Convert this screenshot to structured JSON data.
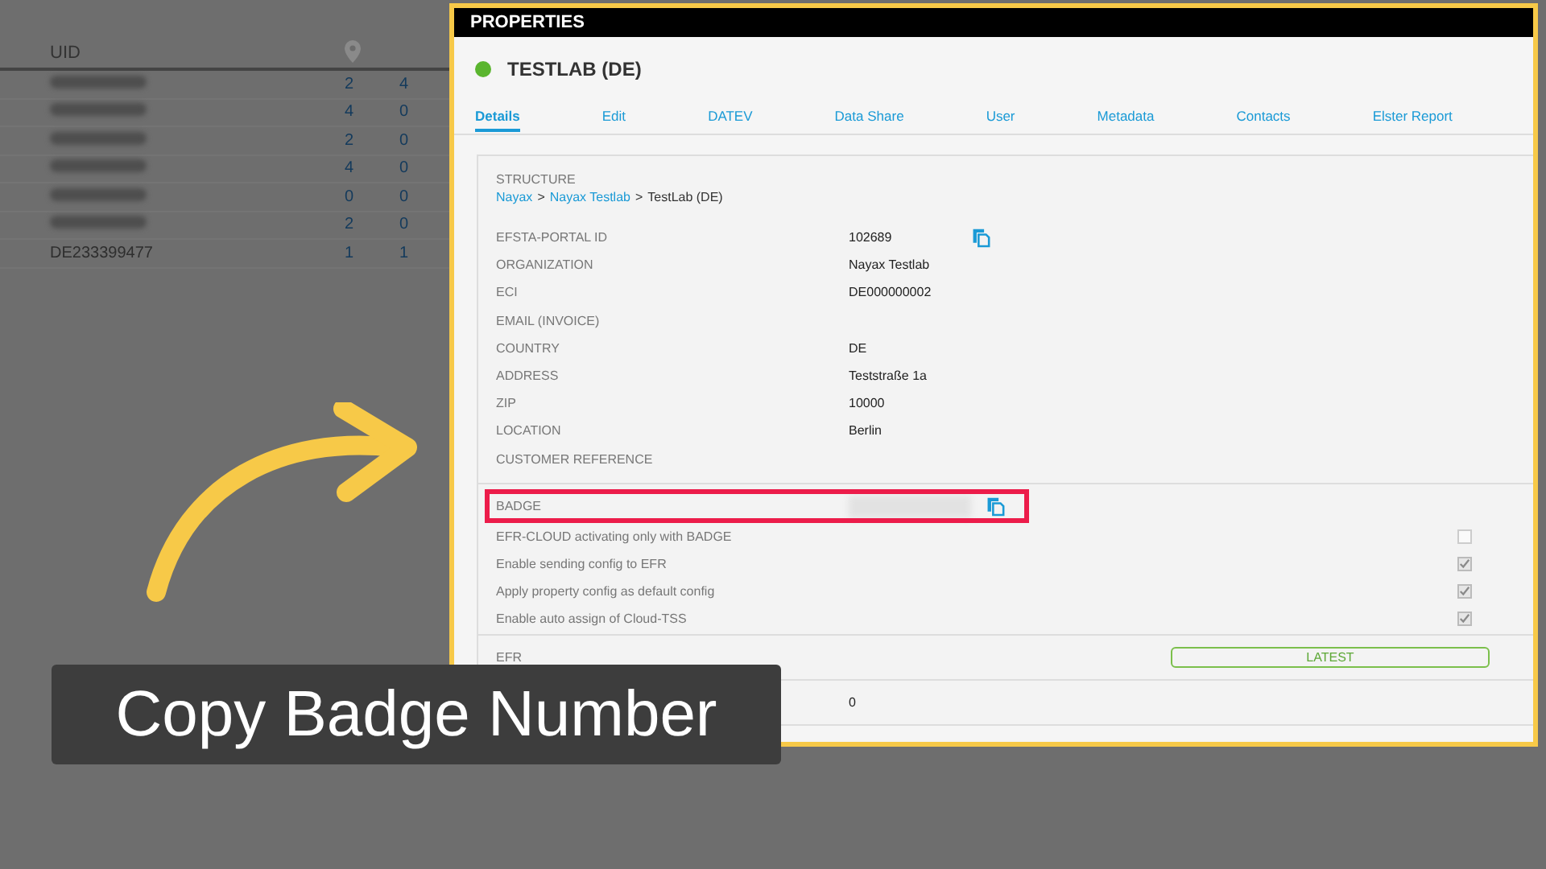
{
  "table": {
    "columns": [
      {
        "label": "UID"
      }
    ],
    "rows": [
      {
        "uid": "",
        "count": "2",
        "column_3": "4"
      },
      {
        "uid": "",
        "count": "4",
        "column_3": "0"
      },
      {
        "uid": "",
        "count": "2",
        "column_3": "0"
      },
      {
        "uid": "",
        "count": "4",
        "column_3": "0"
      },
      {
        "uid": "",
        "count": "0",
        "column_3": "0"
      },
      {
        "uid": "",
        "count": "2",
        "column_3": "0"
      },
      {
        "uid": "DE233399477",
        "count": "1",
        "column_3": "1"
      }
    ]
  },
  "properties": {
    "title": "PROPERTIES",
    "name": "TESTLAB (DE)",
    "online": true,
    "tabs": [
      {
        "label": "Details",
        "selected": true
      },
      {
        "label": "Edit",
        "selected": false
      },
      {
        "label": "DATEV",
        "selected": false
      },
      {
        "label": "Data Share",
        "selected": false
      },
      {
        "label": "User",
        "selected": false
      },
      {
        "label": "Metadata",
        "selected": false
      },
      {
        "label": "Contacts",
        "selected": false
      },
      {
        "label": "Elster Report",
        "selected": false
      }
    ],
    "structure_label": "STRUCTURE",
    "breadcrumb": [
      {
        "kind": "link",
        "label": "Nayax"
      },
      {
        "kind": "separator",
        "label": ">"
      },
      {
        "kind": "link",
        "label": "Nayax Testlab"
      },
      {
        "kind": "separator",
        "label": ">"
      },
      {
        "kind": "current",
        "label": "TestLab (DE)"
      }
    ],
    "fields": [
      {
        "label": "EFSTA-PORTAL ID",
        "value": "102689",
        "copy": true
      },
      {
        "label": "ORGANIZATION",
        "value": "Nayax Testlab",
        "copy": false
      },
      {
        "label": "ECI",
        "value": "DE000000002",
        "copy": false
      },
      {
        "label": "EMAIL (INVOICE)",
        "copy": false
      },
      {
        "label": "COUNTRY",
        "value": "DE",
        "copy": false
      },
      {
        "label": "ADDRESS",
        "value": "Teststraße 1a",
        "copy": false
      },
      {
        "label": "ZIP",
        "value": "10000",
        "copy": false
      },
      {
        "label": "LOCATION",
        "value": "Berlin",
        "copy": false
      },
      {
        "label": "CUSTOMER REFERENCE",
        "copy": false
      }
    ],
    "badge": {
      "label": "BADGE",
      "highlighted": true
    },
    "options": [
      {
        "label": "EFR-CLOUD activating only with BADGE",
        "checked": false
      },
      {
        "label": "Enable sending config to EFR",
        "checked": true
      },
      {
        "label": "Apply property config as default config",
        "checked": true
      },
      {
        "label": "Enable auto assign of Cloud-TSS",
        "checked": true
      }
    ],
    "efr": {
      "label": "EFR",
      "status": "LATEST"
    },
    "last_row": {
      "value": "0"
    }
  },
  "caption": "Copy Badge Number"
}
